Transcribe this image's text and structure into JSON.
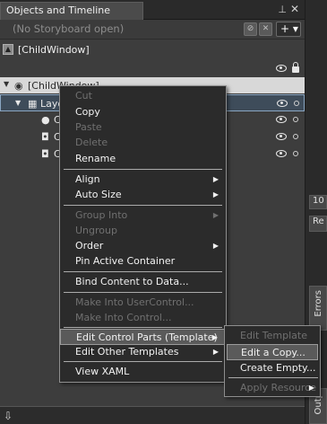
{
  "panel": {
    "tab_title": "Objects and Timeline",
    "storyboard_text": "(No Storyboard open)",
    "add_label": "+ ▾"
  },
  "scope": {
    "label": "[ChildWindow]"
  },
  "tree": {
    "rows": [
      {
        "label": "[ChildWindow]"
      },
      {
        "label": "Layo"
      },
      {
        "label": "C"
      },
      {
        "label": "C"
      },
      {
        "label": "C"
      }
    ]
  },
  "right": {
    "num": "10",
    "re": "Re",
    "errors": "Errors",
    "outp": "Outp"
  },
  "context_menu": {
    "items": [
      {
        "label": "Cut",
        "enabled": false
      },
      {
        "label": "Copy",
        "enabled": true
      },
      {
        "label": "Paste",
        "enabled": false
      },
      {
        "label": "Delete",
        "enabled": false
      },
      {
        "label": "Rename",
        "enabled": true
      },
      {
        "label": "Align",
        "enabled": true,
        "submenu": true
      },
      {
        "label": "Auto Size",
        "enabled": true,
        "submenu": true
      },
      {
        "label": "Group Into",
        "enabled": false,
        "submenu": true
      },
      {
        "label": "Ungroup",
        "enabled": false
      },
      {
        "label": "Order",
        "enabled": true,
        "submenu": true
      },
      {
        "label": "Pin Active Container",
        "enabled": true
      },
      {
        "label": "Bind Content to Data...",
        "enabled": true
      },
      {
        "label": "Make Into UserControl...",
        "enabled": false
      },
      {
        "label": "Make Into Control...",
        "enabled": false
      },
      {
        "label": "Edit Control Parts (Template)",
        "enabled": true,
        "submenu": true,
        "highlighted": true
      },
      {
        "label": "Edit Other Templates",
        "enabled": true,
        "submenu": true
      },
      {
        "label": "View XAML",
        "enabled": true
      }
    ]
  },
  "submenu": {
    "items": [
      {
        "label": "Edit Template",
        "enabled": false
      },
      {
        "label": "Edit a Copy...",
        "enabled": true,
        "highlighted": true
      },
      {
        "label": "Create Empty...",
        "enabled": true
      },
      {
        "label": "Apply Resource",
        "enabled": false,
        "submenu": true
      }
    ]
  }
}
